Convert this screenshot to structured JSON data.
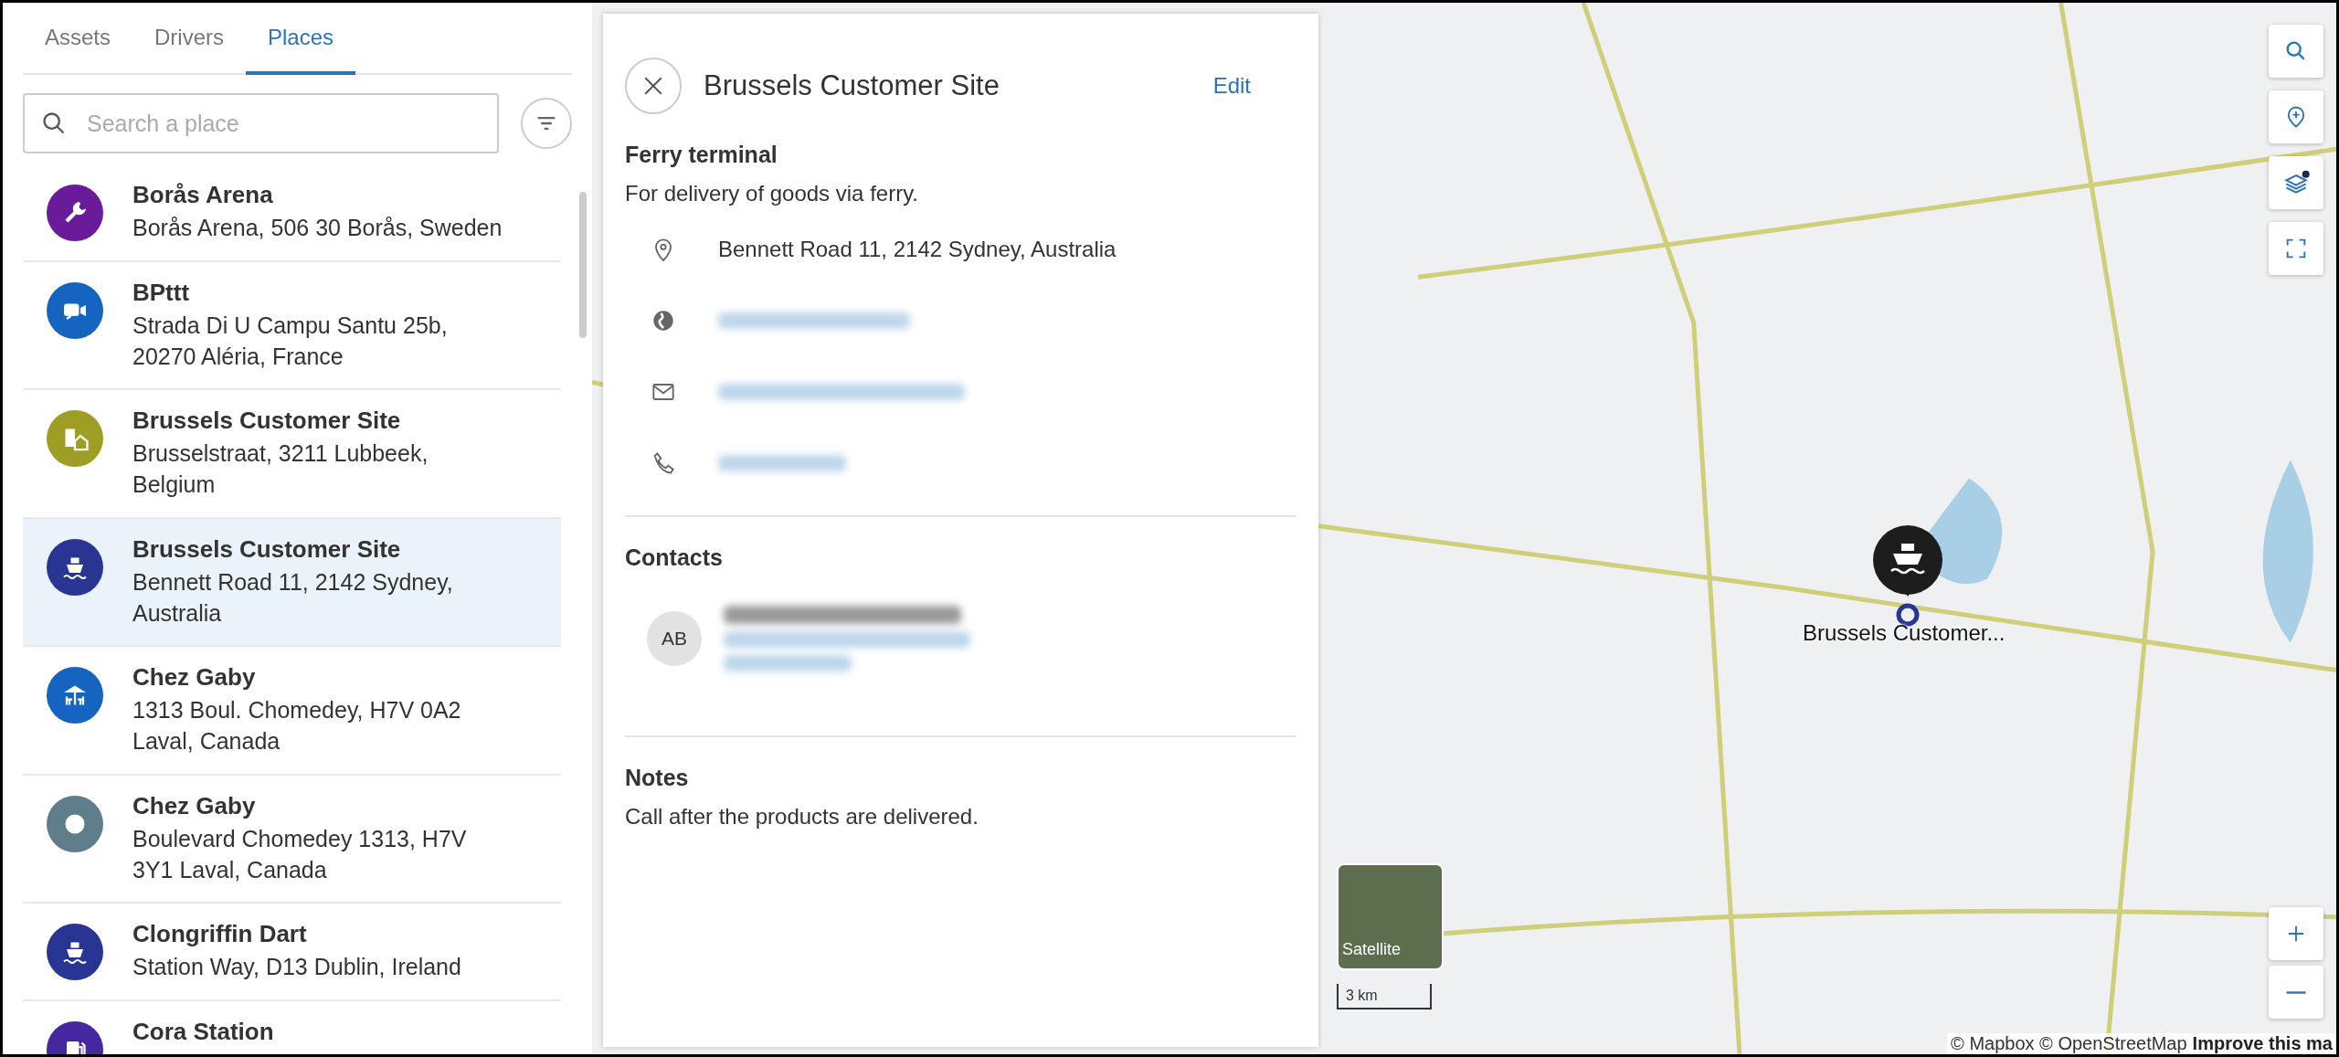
{
  "tabs": [
    {
      "label": "Assets",
      "selected": false
    },
    {
      "label": "Drivers",
      "selected": false
    },
    {
      "label": "Places",
      "selected": true
    }
  ],
  "search": {
    "placeholder": "Search a place"
  },
  "places": [
    {
      "name": "Borås Arena",
      "address": "Borås Arena, 506 30 Borås, Sweden",
      "kind": "wrench",
      "color": "#6a1b9a",
      "selected": false
    },
    {
      "name": "BPttt",
      "address": "Strada Di U Campu Santu 25b, 20270 Aléria, France",
      "kind": "video",
      "color": "#1565c0",
      "selected": false
    },
    {
      "name": "Brussels Customer Site",
      "address": "Brusselstraat, 3211 Lubbeek, Belgium",
      "kind": "building",
      "color": "#9e9d24",
      "selected": false
    },
    {
      "name": "Brussels Customer Site",
      "address": "Bennett Road 11, 2142 Sydney, Australia",
      "kind": "ship",
      "color": "#283593",
      "selected": true
    },
    {
      "name": "Chez Gaby",
      "address": "1313 Boul. Chomedey, H7V 0A2 Laval, Canada",
      "kind": "picnic",
      "color": "#1565c0",
      "selected": false
    },
    {
      "name": "Chez Gaby",
      "address": "Boulevard Chomedey 1313, H7V 3Y1 Laval, Canada",
      "kind": "ring",
      "color": "#607d8b",
      "selected": false
    },
    {
      "name": "Clongriffin Dart",
      "address": "Station Way, D13 Dublin, Ireland",
      "kind": "ship",
      "color": "#283593",
      "selected": false
    },
    {
      "name": "Cora Station",
      "kind": "fuel",
      "color": "#4527a0",
      "selected": false
    }
  ],
  "detail": {
    "title": "Brussels Customer Site",
    "edit": "Edit",
    "category": "Ferry terminal",
    "description": "For delivery of goods via ferry.",
    "info": [
      {
        "kind": "address",
        "text": "Bennett Road 11, 2142 Sydney, Australia",
        "blurred": false
      },
      {
        "kind": "website",
        "blurred": true
      },
      {
        "kind": "email",
        "blurred": true
      },
      {
        "kind": "phone",
        "blurred": true
      }
    ],
    "contacts_heading": "Contacts",
    "contacts": [
      {
        "initials": "AB",
        "blurred": true
      }
    ],
    "notes_heading": "Notes",
    "notes": "Call after the products are delivered."
  },
  "map": {
    "marker_label": "Brussels Customer...",
    "satellite_label": "Satellite",
    "scale": "3 km",
    "attribution": "© Mapbox © OpenStreetMap",
    "improve_link": "Improve this ma"
  }
}
